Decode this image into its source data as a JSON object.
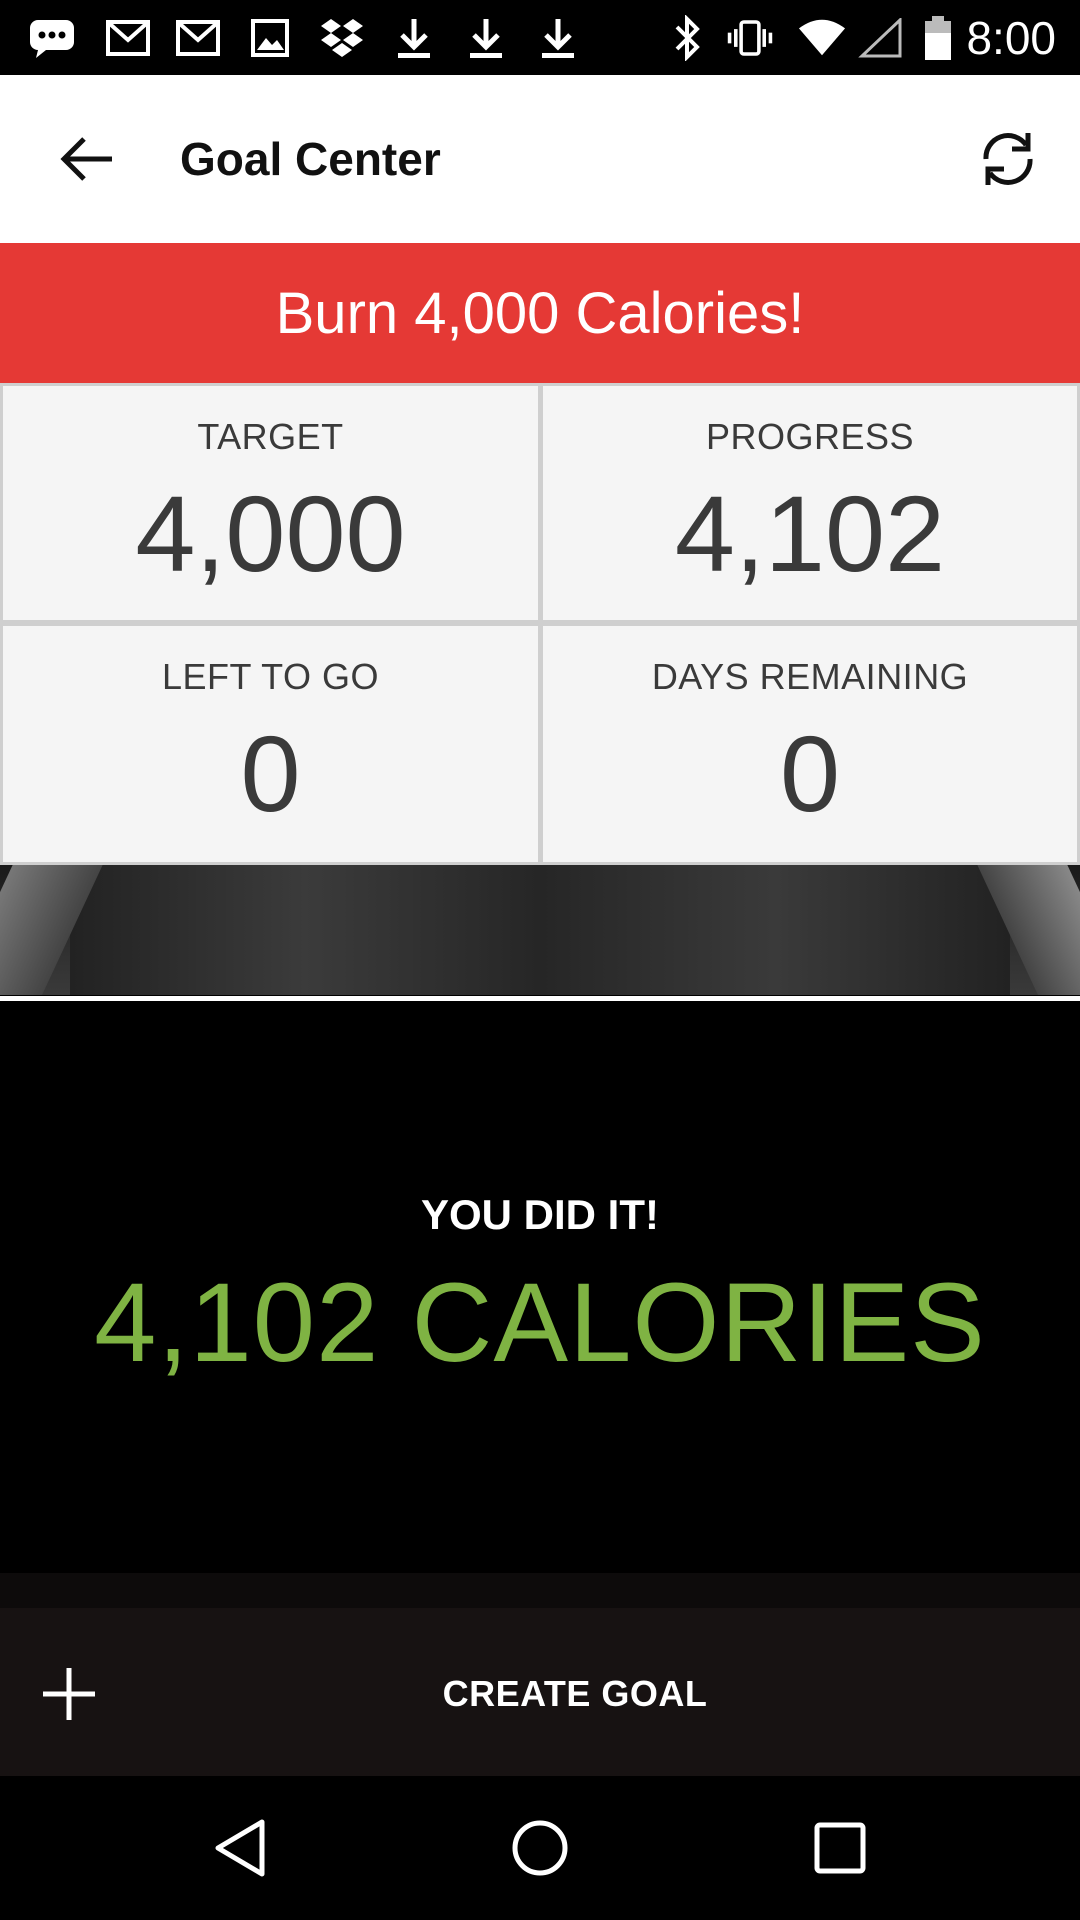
{
  "status_bar": {
    "time": "8:00",
    "notification_icons": [
      "messages-icon",
      "gmail-icon",
      "gmail-icon",
      "image-icon",
      "dropbox-icon",
      "download-icon",
      "download-icon",
      "download-icon"
    ],
    "system_icons": [
      "bluetooth-icon",
      "vibrate-icon",
      "wifi-icon",
      "signal-icon",
      "battery-icon"
    ]
  },
  "app_bar": {
    "title": "Goal Center",
    "back_icon": "arrow-left-icon",
    "refresh_icon": "refresh-icon"
  },
  "banner": {
    "text": "Burn 4,000 Calories!",
    "color": "#e53935"
  },
  "stats": [
    {
      "label": "TARGET",
      "value": "4,000"
    },
    {
      "label": "PROGRESS",
      "value": "4,102"
    },
    {
      "label": "LEFT TO GO",
      "value": "0"
    },
    {
      "label": "DAYS REMAINING",
      "value": "0"
    }
  ],
  "success": {
    "headline": "YOU DID IT!",
    "amount": "4,102 CALORIES",
    "accent_color": "#7fb343"
  },
  "create_goal": {
    "label": "CREATE GOAL",
    "icon": "plus-icon"
  },
  "nav_bar": {
    "buttons": [
      "back-triangle-icon",
      "home-circle-icon",
      "recents-square-icon"
    ]
  }
}
